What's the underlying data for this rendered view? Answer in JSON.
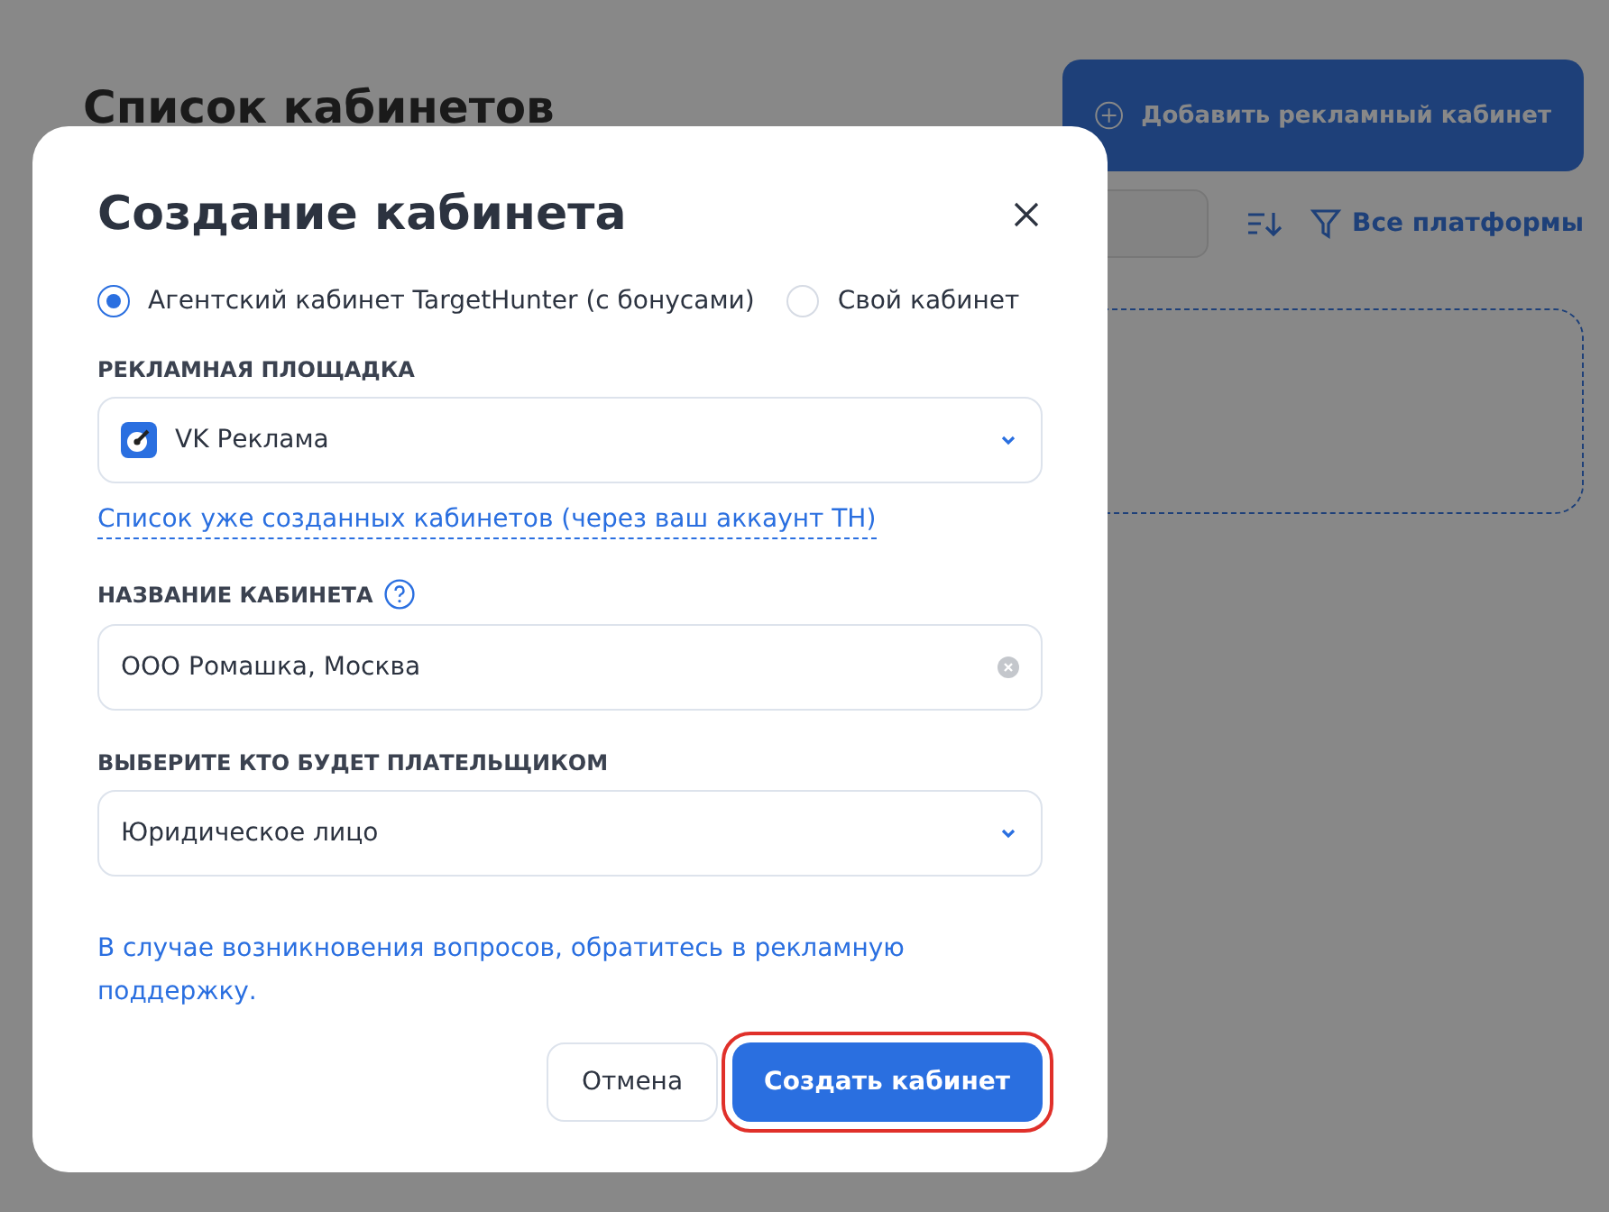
{
  "page": {
    "title": "Список кабинетов",
    "add_button": "Добавить рекламный кабинет",
    "platform_filter": "Все платформы"
  },
  "dialog": {
    "title": "Создание кабинета",
    "account_types": [
      {
        "label": "Агентский кабинет TargetHunter (с бонусами)",
        "selected": true
      },
      {
        "label": "Свой кабинет",
        "selected": false
      }
    ],
    "platform": {
      "label": "РЕКЛАМНАЯ ПЛОЩАДКА",
      "value": "VK Реклама"
    },
    "existing_link": "Список уже созданных кабинетов (через ваш аккаунт TH)",
    "name": {
      "label": "НАЗВАНИЕ КАБИНЕТА",
      "value": "ООО Ромашка, Москва"
    },
    "payer": {
      "label": "ВЫБЕРИТЕ КТО БУДЕТ ПЛАТЕЛЬЩИКОМ",
      "value": "Юридическое лицо"
    },
    "help_text": "В случае возникновения вопросов, обратитесь в рекламную поддержку.",
    "buttons": [
      {
        "label": "Отмена",
        "kind": "secondary",
        "highlighted": false
      },
      {
        "label": "Создать кабинет",
        "kind": "primary",
        "highlighted": true
      }
    ]
  }
}
